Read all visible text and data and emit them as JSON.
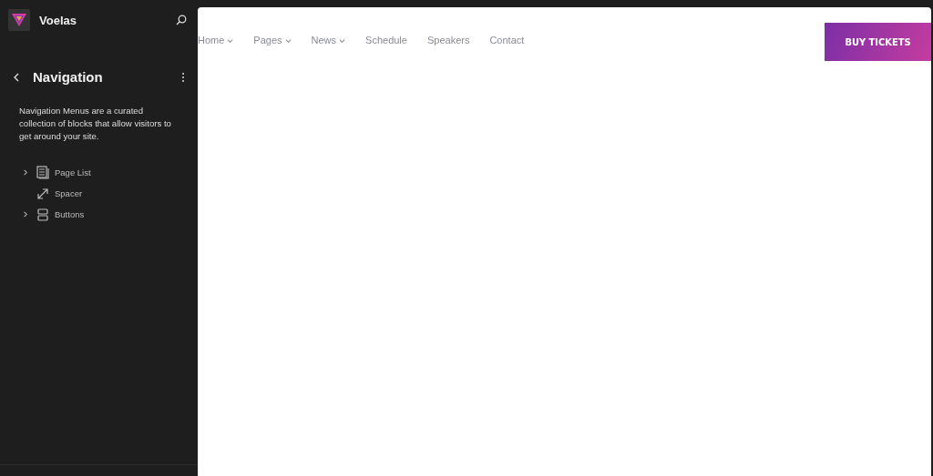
{
  "sidebar": {
    "site_title": "Voelas",
    "panel_title": "Navigation",
    "description": "Navigation Menus are a curated collection of blocks that allow visitors to get around your site.",
    "blocks": [
      {
        "kind": "pagelist",
        "label": "Page List",
        "expandable": true
      },
      {
        "kind": "spacer",
        "label": "Spacer",
        "expandable": false
      },
      {
        "kind": "buttons",
        "label": "Buttons",
        "expandable": true
      }
    ]
  },
  "preview": {
    "menu": [
      {
        "label": "Home",
        "has_submenu": true
      },
      {
        "label": "Pages",
        "has_submenu": true
      },
      {
        "label": "News",
        "has_submenu": true
      },
      {
        "label": "Schedule",
        "has_submenu": false
      },
      {
        "label": "Speakers",
        "has_submenu": false
      },
      {
        "label": "Contact",
        "has_submenu": false
      }
    ],
    "cta": "BUY TICKETS"
  }
}
